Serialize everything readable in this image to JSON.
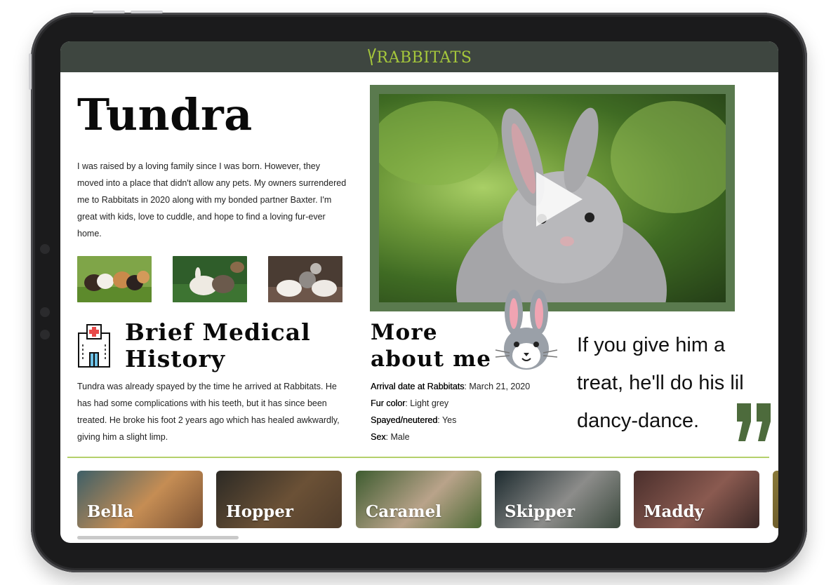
{
  "header": {
    "logo_text": "RABBITATS",
    "brand_color": "#a5c73b",
    "bar_color": "#3e4640"
  },
  "pet": {
    "name": "Tundra",
    "bio": "I was raised by a loving family since I was born. However, they moved into a place that didn't allow any pets. My owners surrendered me to Rabbitats in 2020 along with my bonded partner Baxter. I'm great with kids, love to cuddle, and hope to find a loving fur-ever home."
  },
  "medical": {
    "title": "Brief Medical History",
    "text": "Tundra was already spayed by the time he arrived at Rabbitats. He has had some complications with his teeth, but it has since been treated. He broke his foot 2 years ago which has healed awkwardly, giving him a slight limp."
  },
  "video": {
    "icon": "play-icon",
    "frame_color": "#5a7a4e"
  },
  "more": {
    "title": "More about me",
    "facts": [
      {
        "label": "Arrival date at Rabbitats",
        "value": ": March 21, 2020"
      },
      {
        "label": "Fur color",
        "value": ": Light grey"
      },
      {
        "label": "Spayed/neutered",
        "value": ": Yes"
      },
      {
        "label": "Sex",
        "value": ": Male"
      }
    ]
  },
  "quote": {
    "text": "If you give him a treat, he'll do his lil dancy-dance.",
    "mark_color": "#4d6b3c"
  },
  "others": [
    {
      "name": "Bella"
    },
    {
      "name": "Hopper"
    },
    {
      "name": "Caramel"
    },
    {
      "name": "Skipper"
    },
    {
      "name": "Maddy"
    }
  ]
}
